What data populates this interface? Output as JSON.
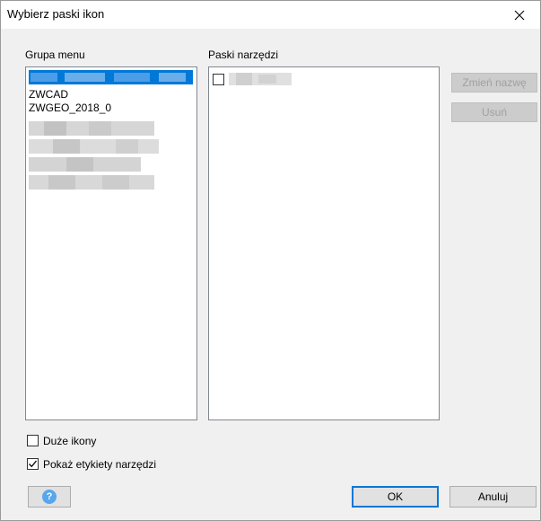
{
  "window": {
    "title": "Wybierz paski ikon"
  },
  "menu_group": {
    "label": "Grupa menu",
    "items": [
      "ZWCAD",
      "ZWGEO_2018_0"
    ]
  },
  "toolbars": {
    "label": "Paski narzędzi"
  },
  "buttons": {
    "rename": "Zmień nazwę",
    "delete": "Usuń",
    "ok": "OK",
    "cancel": "Anuluj",
    "help_glyph": "?"
  },
  "options": {
    "large_icons": {
      "label": "Duże ikony",
      "checked": false
    },
    "show_labels": {
      "label": "Pokaż etykiety narzędzi",
      "checked": true
    }
  },
  "colors": {
    "accent": "#0078d7",
    "help": "#57a6ee"
  }
}
